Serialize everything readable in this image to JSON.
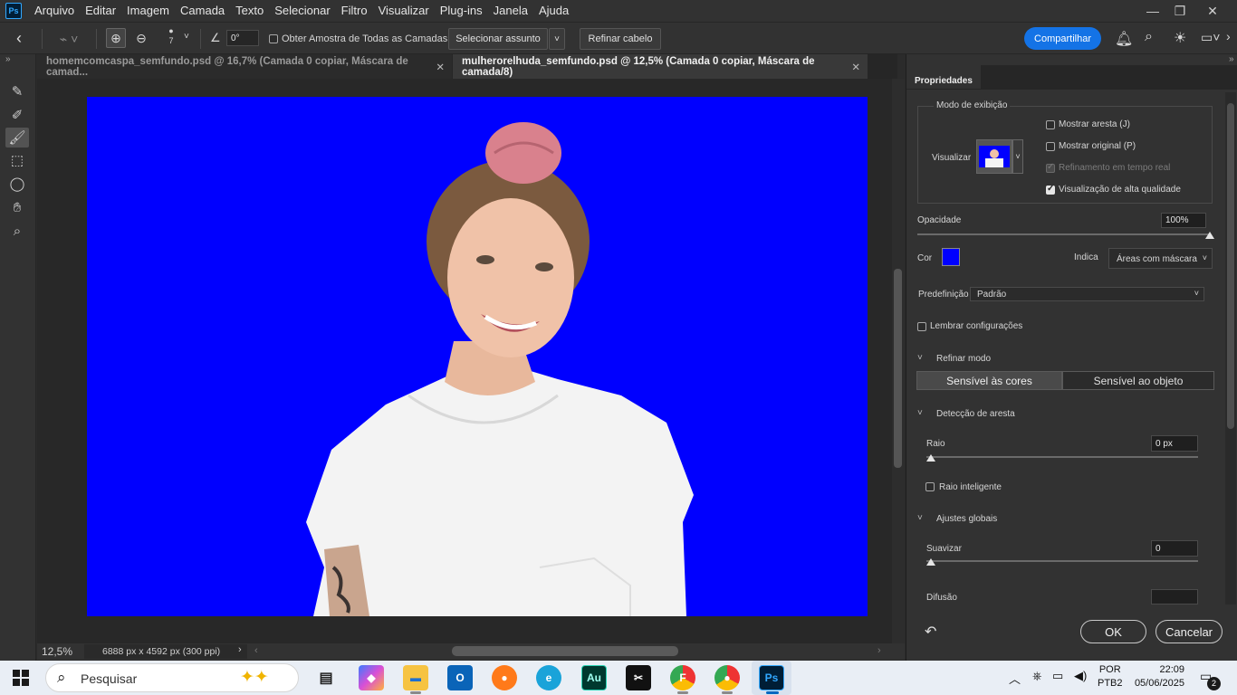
{
  "menu": {
    "logo": "Ps",
    "items": [
      "Arquivo",
      "Editar",
      "Imagem",
      "Camada",
      "Texto",
      "Selecionar",
      "Filtro",
      "Visualizar",
      "Plug-ins",
      "Janela",
      "Ajuda"
    ]
  },
  "options_bar": {
    "brush_size": "7",
    "angle": "0°",
    "sample_all_layers": "Obter Amostra de Todas as Camadas",
    "select_subject": "Selecionar assunto",
    "refine_hair": "Refinar cabelo",
    "share": "Compartilhar"
  },
  "tabs": [
    {
      "label": "homemcomcaspa_semfundo.psd @ 16,7% (Camada 0 copiar, Máscara de camad...",
      "active": false
    },
    {
      "label": "mulherorelhuda_semfundo.psd @ 12,5% (Camada 0 copiar, Máscara de camada/8)",
      "active": true
    }
  ],
  "status": {
    "zoom": "12,5%",
    "doc_size": "6888 px x 4592 px (300 ppi)"
  },
  "properties": {
    "panel_tab": "Propriedades",
    "view_mode": {
      "title": "Modo de exibição",
      "view_label": "Visualizar",
      "show_edge": "Mostrar aresta (J)",
      "show_original": "Mostrar original (P)",
      "realtime_refine": "Refinamento em tempo real",
      "high_quality": "Visualização de alta qualidade"
    },
    "opacity_label": "Opacidade",
    "opacity_value": "100%",
    "opacity_fraction": 1.0,
    "color_label": "Cor",
    "color_value": "#0000ff",
    "indicates_label": "Indica",
    "indicates_value": "Áreas com máscara",
    "preset_label": "Predefinição",
    "preset_value": "Padrão",
    "remember_settings": "Lembrar configurações",
    "refine_mode": {
      "title": "Refinar modo",
      "color_aware": "Sensível às cores",
      "object_aware": "Sensível ao objeto"
    },
    "edge_detection": {
      "title": "Detecção de aresta",
      "radius_label": "Raio",
      "radius_value": "0 px",
      "smart_radius": "Raio inteligente"
    },
    "global": {
      "title": "Ajustes globais",
      "smooth_label": "Suavizar",
      "smooth_value": "0",
      "feather_label": "Difusão"
    },
    "ok": "OK",
    "cancel": "Cancelar"
  },
  "taskbar": {
    "search_placeholder": "Pesquisar",
    "lang_top": "POR",
    "lang_bottom": "PTB2",
    "time": "22:09",
    "date": "05/06/2025",
    "notif_count": "2"
  },
  "colors": {
    "accent": "#1473e6",
    "canvas_bg": "#0000ff"
  }
}
